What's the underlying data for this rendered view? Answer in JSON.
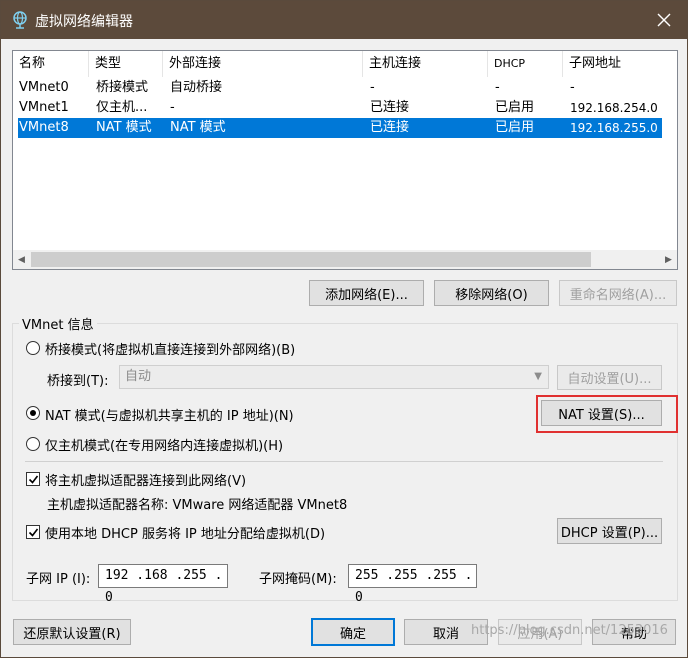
{
  "window": {
    "title": "虚拟网络编辑器",
    "icon": "network-globe-icon",
    "close_icon": "close-icon"
  },
  "network_table": {
    "columns": [
      "名称",
      "类型",
      "外部连接",
      "主机连接",
      "DHCP",
      "子网地址"
    ],
    "rows": [
      {
        "name": "VMnet0",
        "type": "桥接模式",
        "external": "自动桥接",
        "host": "-",
        "dhcp": "-",
        "subnet": "-",
        "selected": false
      },
      {
        "name": "VMnet1",
        "type": "仅主机...",
        "external": "-",
        "host": "已连接",
        "dhcp": "已启用",
        "subnet": "192.168.254.0",
        "selected": false
      },
      {
        "name": "VMnet8",
        "type": "NAT 模式",
        "external": "NAT 模式",
        "host": "已连接",
        "dhcp": "已启用",
        "subnet": "192.168.255.0",
        "selected": true
      }
    ]
  },
  "table_buttons": {
    "add": "添加网络(E)...",
    "remove": "移除网络(O)",
    "rename": "重命名网络(A)..."
  },
  "vmnet_info": {
    "group_label": "VMnet 信息",
    "bridge_mode": "桥接模式(将虚拟机直接连接到外部网络)(B)",
    "bridge_to_label": "桥接到(T):",
    "bridge_to_value": "自动",
    "auto_settings": "自动设置(U)...",
    "nat_mode": "NAT 模式(与虚拟机共享主机的 IP 地址)(N)",
    "nat_settings": "NAT 设置(S)...",
    "host_only_mode": "仅主机模式(在专用网络内连接虚拟机)(H)",
    "selected_mode": "nat",
    "connect_adapter": "将主机虚拟适配器连接到此网络(V)",
    "connect_adapter_checked": true,
    "adapter_name": "主机虚拟适配器名称: VMware 网络适配器 VMnet8",
    "use_dhcp": "使用本地 DHCP 服务将 IP 地址分配给虚拟机(D)",
    "use_dhcp_checked": true,
    "dhcp_settings": "DHCP 设置(P)...",
    "subnet_ip_label": "子网 IP (I):",
    "subnet_ip_value": "192 .168 .255 .  0",
    "subnet_mask_label": "子网掩码(M):",
    "subnet_mask_value": "255 .255 .255 .  0"
  },
  "footer": {
    "restore_defaults": "还原默认设置(R)",
    "ok": "确定",
    "cancel": "取消",
    "apply": "应用(A)",
    "help": "帮助",
    "watermark": "https://blog.csdn.net/1253016"
  },
  "colors": {
    "titlebar": "#5c4a3b",
    "selection": "#0078d7",
    "highlight_box": "#e03030"
  }
}
